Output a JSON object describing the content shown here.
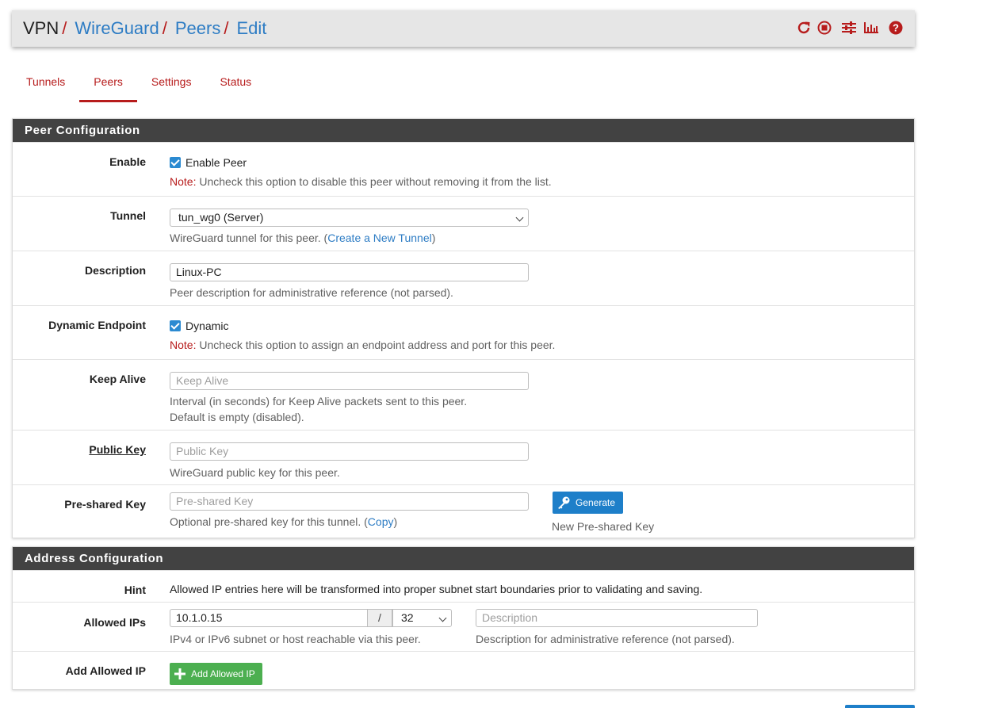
{
  "breadcrumb": {
    "root": "VPN",
    "items": [
      "WireGuard",
      "Peers",
      "Edit"
    ],
    "separator": "/"
  },
  "header_icons": [
    "reload-icon",
    "stop-icon",
    "sliders-icon",
    "bar-chart-icon",
    "help-icon"
  ],
  "tabs": [
    {
      "label": "Tunnels",
      "active": false
    },
    {
      "label": "Peers",
      "active": true
    },
    {
      "label": "Settings",
      "active": false
    },
    {
      "label": "Status",
      "active": false
    }
  ],
  "peer_config": {
    "heading": "Peer Configuration",
    "enable": {
      "label": "Enable",
      "checkbox_label": "Enable Peer",
      "checked": true,
      "note_prefix": "Note:",
      "note_text": " Uncheck this option to disable this peer without removing it from the list."
    },
    "tunnel": {
      "label": "Tunnel",
      "value": "tun_wg0 (Server)",
      "help_prefix": "WireGuard tunnel for this peer. (",
      "help_link": "Create a New Tunnel",
      "help_suffix": ")"
    },
    "description": {
      "label": "Description",
      "value": "Linux-PC",
      "help": "Peer description for administrative reference (not parsed)."
    },
    "dynamic_endpoint": {
      "label": "Dynamic Endpoint",
      "checkbox_label": "Dynamic",
      "checked": true,
      "note_prefix": "Note:",
      "note_text": " Uncheck this option to assign an endpoint address and port for this peer."
    },
    "keep_alive": {
      "label": "Keep Alive",
      "placeholder": "Keep Alive",
      "help_line1": "Interval (in seconds) for Keep Alive packets sent to this peer.",
      "help_line2": "Default is empty (disabled)."
    },
    "public_key": {
      "label": "Public Key",
      "placeholder": "Public Key",
      "help": "WireGuard public key for this peer."
    },
    "preshared_key": {
      "label": "Pre-shared Key",
      "placeholder": "Pre-shared Key",
      "help_prefix": "Optional pre-shared key for this tunnel. (",
      "help_link": "Copy",
      "help_suffix": ")",
      "generate_button": "Generate",
      "generate_help": "New Pre-shared Key"
    }
  },
  "address_config": {
    "heading": "Address Configuration",
    "hint": {
      "label": "Hint",
      "text": "Allowed IP entries here will be transformed into proper subnet start boundaries prior to validating and saving."
    },
    "allowed_ips": {
      "label": "Allowed IPs",
      "address": "10.1.0.15",
      "slash": "/",
      "mask": "32",
      "address_help": "IPv4 or IPv6 subnet or host reachable via this peer.",
      "description_placeholder": "Description",
      "description_help": "Description for administrative reference (not parsed)."
    },
    "add_allowed_ip": {
      "label": "Add Allowed IP",
      "button": "Add Allowed IP"
    }
  },
  "colors": {
    "accent_red": "#b71c1c",
    "link_blue": "#2d7cc4",
    "heading_dark": "#424242",
    "button_blue": "#1e7fc9",
    "button_green": "#4caf50"
  }
}
